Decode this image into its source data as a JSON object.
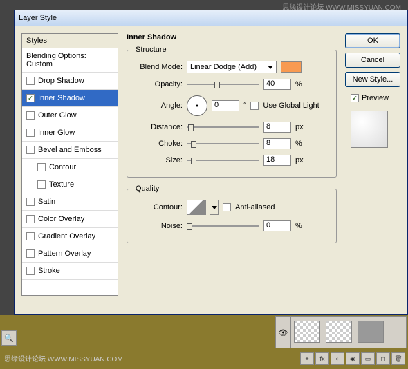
{
  "watermark_top": "思缘设计论坛  WWW.MISSYUAN.COM",
  "watermark_bottom": "思缘设计论坛  WWW.MISSYUAN.COM",
  "dialog": {
    "title": "Layer Style",
    "styles_header": "Styles",
    "blending_options": "Blending Options: Custom",
    "items": [
      {
        "label": "Drop Shadow",
        "checked": false
      },
      {
        "label": "Inner Shadow",
        "checked": true,
        "selected": true
      },
      {
        "label": "Outer Glow",
        "checked": false
      },
      {
        "label": "Inner Glow",
        "checked": false
      },
      {
        "label": "Bevel and Emboss",
        "checked": false
      },
      {
        "label": "Contour",
        "checked": false,
        "sub": true
      },
      {
        "label": "Texture",
        "checked": false,
        "sub": true
      },
      {
        "label": "Satin",
        "checked": false
      },
      {
        "label": "Color Overlay",
        "checked": false
      },
      {
        "label": "Gradient Overlay",
        "checked": false
      },
      {
        "label": "Pattern Overlay",
        "checked": false
      },
      {
        "label": "Stroke",
        "checked": false
      }
    ]
  },
  "panel": {
    "title": "Inner Shadow",
    "structure_legend": "Structure",
    "quality_legend": "Quality",
    "blend_mode_label": "Blend Mode:",
    "blend_mode_value": "Linear Dodge (Add)",
    "swatch_color": "#f89a51",
    "opacity_label": "Opacity:",
    "opacity_value": "40",
    "opacity_unit": "%",
    "angle_label": "Angle:",
    "angle_value": "0",
    "angle_unit": "°",
    "global_light_label": "Use Global Light",
    "distance_label": "Distance:",
    "distance_value": "8",
    "distance_unit": "px",
    "choke_label": "Choke:",
    "choke_value": "8",
    "choke_unit": "%",
    "size_label": "Size:",
    "size_value": "18",
    "size_unit": "px",
    "contour_label": "Contour:",
    "antialiased_label": "Anti-aliased",
    "noise_label": "Noise:",
    "noise_value": "0",
    "noise_unit": "%"
  },
  "buttons": {
    "ok": "OK",
    "cancel": "Cancel",
    "new_style": "New Style...",
    "preview": "Preview"
  }
}
